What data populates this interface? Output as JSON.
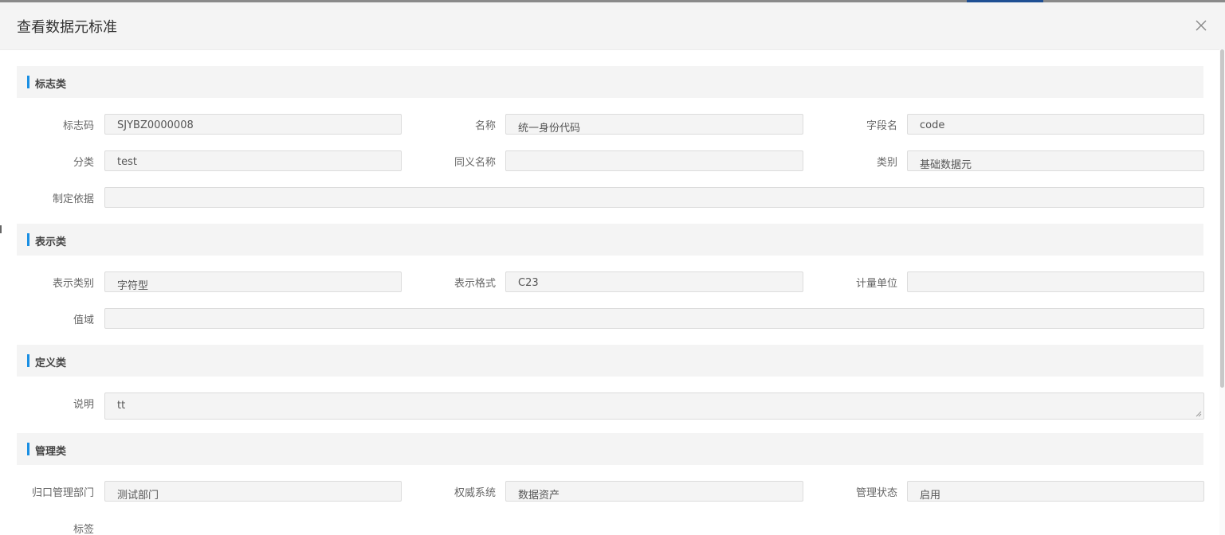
{
  "dialog": {
    "title": "查看数据元标准"
  },
  "sections": {
    "identification": {
      "title": "标志类"
    },
    "representation": {
      "title": "表示类"
    },
    "definition": {
      "title": "定义类"
    },
    "management": {
      "title": "管理类"
    }
  },
  "fields": {
    "id_code": {
      "label": "标志码",
      "value": "SJYBZ0000008"
    },
    "name": {
      "label": "名称",
      "value": "统一身份代码"
    },
    "field_name": {
      "label": "字段名",
      "value": "code"
    },
    "category": {
      "label": "分类",
      "value": "test"
    },
    "synonym": {
      "label": "同义名称",
      "value": ""
    },
    "type": {
      "label": "类别",
      "value": "基础数据元"
    },
    "basis": {
      "label": "制定依据",
      "value": ""
    },
    "repr_type": {
      "label": "表示类别",
      "value": "字符型"
    },
    "repr_format": {
      "label": "表示格式",
      "value": "C23"
    },
    "unit": {
      "label": "计量单位",
      "value": ""
    },
    "value_domain": {
      "label": "值域",
      "value": ""
    },
    "description": {
      "label": "说明",
      "value": "tt"
    },
    "department": {
      "label": "归口管理部门",
      "value": "测试部门"
    },
    "authority_sys": {
      "label": "权威系统",
      "value": "数据资产"
    },
    "mgmt_status": {
      "label": "管理状态",
      "value": "启用"
    },
    "tags": {
      "label": "标签",
      "value": ""
    }
  },
  "colors": {
    "accent": "#1a8fe3",
    "header_bg": "#f4f4f4"
  }
}
